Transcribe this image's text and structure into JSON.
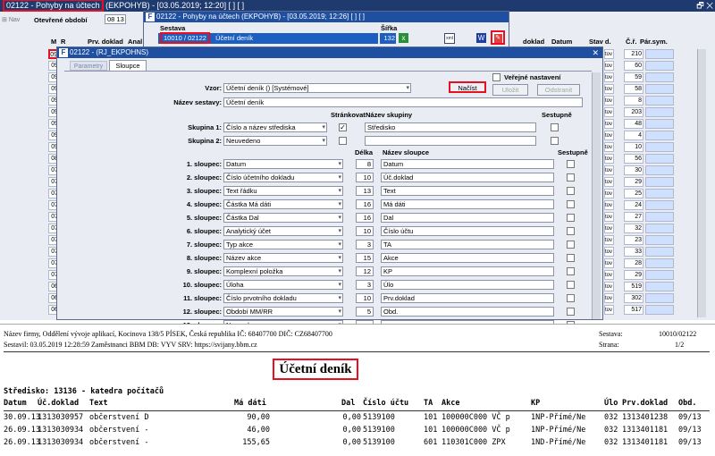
{
  "main_window": {
    "title": "02122 - Pohyby na účtech",
    "title_rest": "(EKPOHYB) - [03.05.2019; 12:20]  [ ]  [ ]",
    "nav_label": "Nav",
    "period_label": "Otevřené období",
    "period_value": "08 13",
    "col_m": "M",
    "col_r": "R",
    "col_prv": "Prv. doklad",
    "col_anal": "Anal",
    "col_doklad": "doklad",
    "col_datum": "Datum",
    "col_stav": "Stav d.",
    "col_cr": "Č.ř.",
    "col_parsym": "Pár.sym.",
    "left_rows": [
      {
        "m": "09",
        "r": "13"
      },
      {
        "m": "09",
        "r": "13"
      },
      {
        "m": "09",
        "r": "13"
      },
      {
        "m": "09",
        "r": "13"
      },
      {
        "m": "09",
        "r": "13"
      },
      {
        "m": "09",
        "r": "13"
      },
      {
        "m": "09",
        "r": "13"
      },
      {
        "m": "09",
        "r": "13"
      },
      {
        "m": "09",
        "r": "13"
      },
      {
        "m": "08",
        "r": "13"
      },
      {
        "m": "07",
        "r": "13"
      },
      {
        "m": "07",
        "r": "13"
      },
      {
        "m": "07",
        "r": "13"
      },
      {
        "m": "07",
        "r": "13"
      },
      {
        "m": "07",
        "r": "13"
      },
      {
        "m": "07",
        "r": "13"
      },
      {
        "m": "07",
        "r": "13"
      },
      {
        "m": "07",
        "r": "13"
      },
      {
        "m": "07",
        "r": "13"
      },
      {
        "m": "07",
        "r": "13"
      },
      {
        "m": "06",
        "r": "13"
      },
      {
        "m": "06",
        "r": "13"
      },
      {
        "m": "06",
        "r": "13"
      }
    ],
    "right_rows": [
      {
        "stav": "tov",
        "cr": "210"
      },
      {
        "stav": "tov",
        "cr": "60"
      },
      {
        "stav": "tov",
        "cr": "59"
      },
      {
        "stav": "tov",
        "cr": "58"
      },
      {
        "stav": "tov",
        "cr": "8"
      },
      {
        "stav": "tov",
        "cr": "203"
      },
      {
        "stav": "tov",
        "cr": "48"
      },
      {
        "stav": "tov",
        "cr": "4"
      },
      {
        "stav": "tov",
        "cr": "10"
      },
      {
        "stav": "tov",
        "cr": "56"
      },
      {
        "stav": "tov",
        "cr": "30"
      },
      {
        "stav": "tov",
        "cr": "29"
      },
      {
        "stav": "tov",
        "cr": "25"
      },
      {
        "stav": "tov",
        "cr": "24"
      },
      {
        "stav": "tov",
        "cr": "27"
      },
      {
        "stav": "tov",
        "cr": "32"
      },
      {
        "stav": "tov",
        "cr": "23"
      },
      {
        "stav": "tov",
        "cr": "33"
      },
      {
        "stav": "tov",
        "cr": "28"
      },
      {
        "stav": "tov",
        "cr": "29"
      },
      {
        "stav": "tov",
        "cr": "519"
      },
      {
        "stav": "tov",
        "cr": "302"
      },
      {
        "stav": "tov",
        "cr": "517"
      }
    ]
  },
  "sestava_window": {
    "title": "02122 - Pohyby na účtech (EKPOHYB) - [03.05.2019; 12:26]  [ ]  [ ]",
    "col_sestava": "Sestava",
    "col_sirka": "Šířka",
    "sestava_code": "10010 / 02122",
    "sestava_name": "Účetní deník",
    "sirka_value": "132",
    "sirka_check": "✓"
  },
  "dialog": {
    "title": "02122 - (RJ_EKPOHNS)",
    "tab_parametry": "Parametry",
    "tab_sloupce": "Sloupce",
    "vzor_label": "Vzor:",
    "vzor_value": "Účetní deník  ()  [Systémové]",
    "nazev_sestavy_label": "Název sestavy:",
    "nazev_sestavy_value": "Účetní deník",
    "nacist_button": "Načíst",
    "ulozit_button": "Uložit",
    "odstranit_button": "Odstranit",
    "verejne_label": "Veřejné nastavení",
    "strankovat_header": "Stránkovat",
    "nazev_skupiny_header": "Název skupiny",
    "sestupne_header": "Sestupně",
    "skupina1_label": "Skupina 1:",
    "skupina1_value": "Číslo a název střediska",
    "skupina1_name": "Středisko",
    "skupina2_label": "Skupina 2:",
    "skupina2_value": "Neuvedeno",
    "delka_header": "Délka",
    "nazev_sloupce_header": "Název sloupce",
    "sestupne_header2": "Sestupně",
    "columns": [
      {
        "label": "1. sloupec:",
        "field": "Datum",
        "len": "8",
        "name": "Datum"
      },
      {
        "label": "2. sloupec:",
        "field": "Číslo účetního dokladu",
        "len": "10",
        "name": "Úč.doklad"
      },
      {
        "label": "3. sloupec:",
        "field": "Text řádku",
        "len": "13",
        "name": "Text"
      },
      {
        "label": "4. sloupec:",
        "field": "Částka Má dáti",
        "len": "16",
        "name": "Má dáti"
      },
      {
        "label": "5. sloupec:",
        "field": "Částka Dal",
        "len": "16",
        "name": "Dal"
      },
      {
        "label": "6. sloupec:",
        "field": "Analytický účet",
        "len": "10",
        "name": "Číslo účtu"
      },
      {
        "label": "7. sloupec:",
        "field": "Typ akce",
        "len": "3",
        "name": "TA"
      },
      {
        "label": "8. sloupec:",
        "field": "Název akce",
        "len": "15",
        "name": "Akce"
      },
      {
        "label": "9. sloupec:",
        "field": "Komplexní položka",
        "len": "12",
        "name": "KP"
      },
      {
        "label": "10. sloupec:",
        "field": "Úloha",
        "len": "3",
        "name": "Úlo"
      },
      {
        "label": "11. sloupec:",
        "field": "Číslo prvotního dokladu",
        "len": "10",
        "name": "Prv.doklad"
      },
      {
        "label": "12. sloupec:",
        "field": "Období MM/RR",
        "len": "5",
        "name": "Obd."
      },
      {
        "label": "13. sloupec:",
        "field": "Neuvedeno",
        "len": "",
        "name": ""
      }
    ]
  },
  "report": {
    "header_line1": "Název firmy, Oddělení vývoje aplikací, Kocinova 138/5 PÍSEK, Česká republika  IČ: 68407700  DIČ: CZ68407700",
    "header_line2": "Sestavil: 03.05.2019 12:28:59 Zaměstnanci BBM  DB: VYV  SRV: https://svijany.bbm.cz",
    "sestava_label": "Sestava:",
    "sestava_value": "10010/02122",
    "strana_label": "Strana:",
    "strana_value": "1/2",
    "title": "Účetní deník",
    "group_heading": "Středisko: 13136 - katedra počítačů",
    "columns": [
      "Datum",
      "Úč.doklad",
      "Text",
      "Má dáti",
      "Dal",
      "Číslo účtu",
      "TA",
      "Akce",
      "KP",
      "Úlo",
      "Prv.doklad",
      "Obd."
    ],
    "rows": [
      [
        "30.09.13",
        "1313030957",
        "občerstvení D",
        "90,00",
        "0,00",
        "5139100",
        "101",
        "100000C000 VČ p",
        "1NP-Přímé/Ne",
        "032",
        "1313401238",
        "09/13"
      ],
      [
        "26.09.13",
        "1313030934",
        "občerstvení -",
        "46,00",
        "0,00",
        "5139100",
        "101",
        "100000C000 VČ p",
        "1NP-Přímé/Ne",
        "032",
        "1313401181",
        "09/13"
      ],
      [
        "26.09.13",
        "1313030934",
        "občerstvení -",
        "155,65",
        "0,00",
        "5139100",
        "601",
        "110301C000 ZPX",
        "1ND-Přímé/Ne",
        "032",
        "1313401181",
        "09/13"
      ]
    ]
  },
  "colors": {
    "title_bar": "#1e3a6e",
    "highlight_border": "#e81020",
    "window_bg": "#e9ecf3"
  }
}
